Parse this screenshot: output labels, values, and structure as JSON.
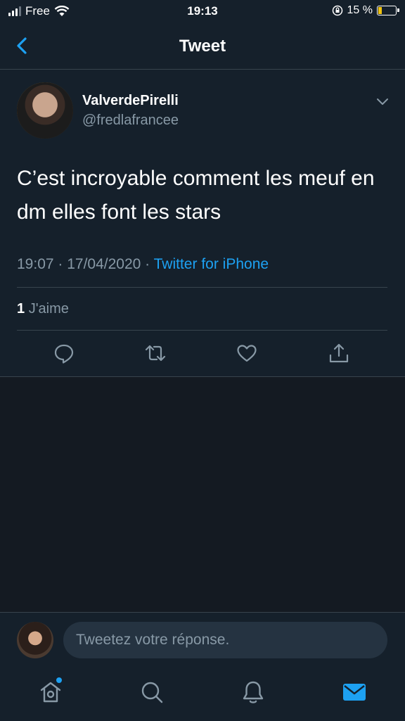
{
  "status_bar": {
    "carrier": "Free",
    "time": "19:13",
    "battery": "15 %"
  },
  "nav": {
    "title": "Tweet"
  },
  "tweet": {
    "name": "ValverdePirelli",
    "handle": "@fredlafrancee",
    "text": "C’est incroyable comment les meuf en dm elles font les stars",
    "time": "19:07",
    "date": "17/04/2020",
    "source": "Twitter for iPhone",
    "likes_count": "1",
    "likes_label": "J'aime"
  },
  "reply": {
    "placeholder": "Tweetez votre réponse."
  },
  "colors": {
    "accent": "#1da1f2",
    "background": "#15202b",
    "muted": "#8899a6"
  },
  "icons": [
    "back-chevron-icon",
    "chevron-down-icon",
    "reply-icon",
    "retweet-icon",
    "like-icon",
    "share-icon",
    "home-icon",
    "search-icon",
    "notifications-icon",
    "messages-icon"
  ]
}
